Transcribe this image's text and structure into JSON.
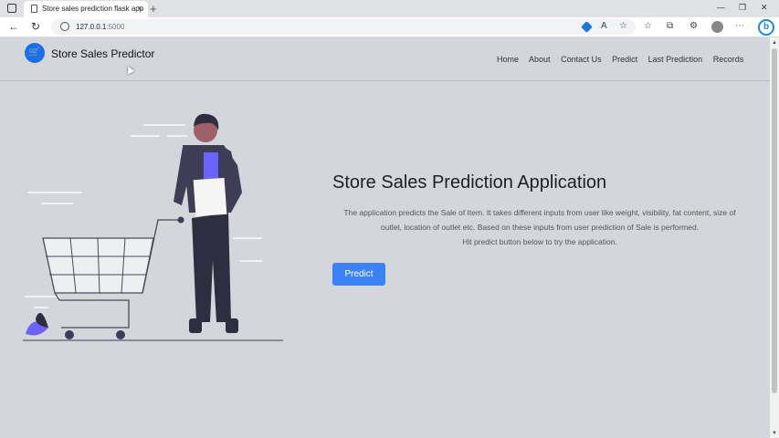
{
  "browser": {
    "tab_title": "Store sales prediction flask app",
    "tab_close": "×",
    "new_tab": "+",
    "url_host": "127.0.0.1",
    "url_port": ":5000",
    "win_minimize": "—",
    "win_maximize": "❐",
    "win_close": "✕"
  },
  "navbar": {
    "brand": "Store Sales Predictor",
    "links": [
      "Home",
      "About",
      "Contact Us",
      "Predict",
      "Last Prediction",
      "Records"
    ]
  },
  "hero": {
    "title": "Store Sales Prediction Application",
    "description": "The application predicts the Sale of Item. It takes different inputs from user like weight, visibility, fat content, size of outlet, location of outlet etc. Based on these inputs from user prediction of Sale is performed.",
    "hint": "Hit predict button below to try the application.",
    "button_label": "Predict"
  },
  "colors": {
    "accent": "#3b82f6",
    "page_bg": "#d3d6db",
    "illustration_accent": "#6c63ff"
  }
}
